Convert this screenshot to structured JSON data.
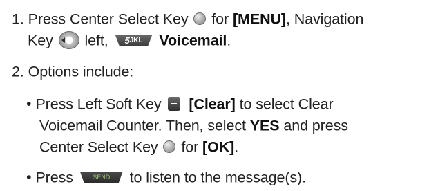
{
  "step1": {
    "number": "1.",
    "text_a": "Press Center Select Key",
    "text_b": "for",
    "menu": "[MENU]",
    "text_c": ", Navigation",
    "text_d": "Key",
    "text_e": "left,",
    "voicemail": "Voicemail",
    "text_f": ".",
    "key5_digit": "5",
    "key5_letters": "JKL"
  },
  "step2": {
    "number": "2.",
    "text": "Options include:"
  },
  "bullet1": {
    "bullet": "•",
    "text_a": "Press Left Soft Key",
    "clear": "[Clear]",
    "text_b": "to select Clear",
    "line2": "Voicemail Counter. Then, select",
    "yes": "YES",
    "text_c": "and press",
    "line3_a": "Center Select Key",
    "line3_b": "for",
    "ok": "[OK]",
    "line3_c": "."
  },
  "bullet2": {
    "bullet": "•",
    "text_a": "Press",
    "send_label": "SEND",
    "text_b": "to listen to the message(s)."
  },
  "icons": {
    "center_key": "center-select-key-icon",
    "nav_key": "navigation-key-left-icon",
    "key5": "key-5-icon",
    "soft_key": "left-soft-key-icon",
    "send_key": "send-key-icon"
  }
}
